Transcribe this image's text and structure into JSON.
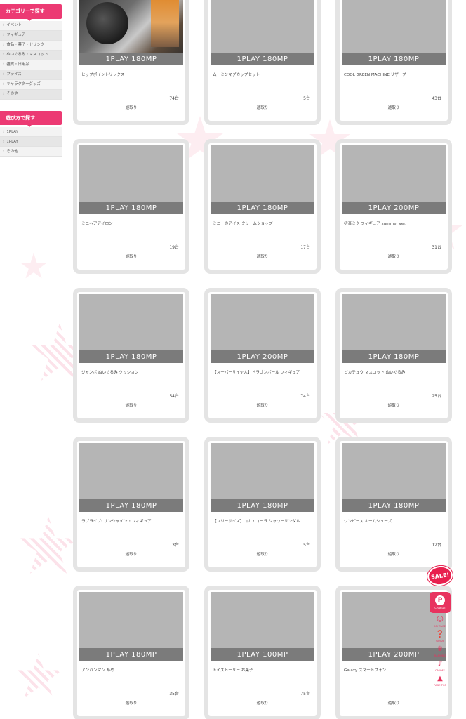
{
  "sidebar": {
    "category_header": "カテゴリーで探す",
    "categories": [
      {
        "label": "イベント"
      },
      {
        "label": "フィギュア"
      },
      {
        "label": "食品・菓子・ドリンク"
      },
      {
        "label": "ぬいぐるみ・マスコット"
      },
      {
        "label": "雑貨・日用品"
      },
      {
        "label": "プライズ"
      },
      {
        "label": "キャラクターグッズ"
      },
      {
        "label": "その他"
      }
    ],
    "play_header": "遊び方で探す",
    "plays": [
      {
        "label": "1PLAY"
      },
      {
        "label": "1PLAY"
      },
      {
        "label": "その他"
      }
    ]
  },
  "items": [
    {
      "price": "1PLAY 180MP",
      "name": "ヒップポイントリレクス",
      "count": "74台",
      "status": "遊取り"
    },
    {
      "price": "1PLAY 180MP",
      "name": "ムーミンマグカップセット",
      "count": "5台",
      "status": "遊取り"
    },
    {
      "price": "1PLAY 180MP",
      "name": "COOL GREEN MACHINE リザーブ",
      "count": "43台",
      "status": "遊取り"
    },
    {
      "price": "1PLAY 180MP",
      "name": "ミニヘアアイロン",
      "count": "19台",
      "status": "遊取り"
    },
    {
      "price": "1PLAY 180MP",
      "name": "ミニーのアイス クリームショップ",
      "count": "17台",
      "status": "遊取り"
    },
    {
      "price": "1PLAY 200MP",
      "name": "初音ミク フィギュア summer ver.",
      "count": "31台",
      "status": "遊取り"
    },
    {
      "price": "1PLAY 180MP",
      "name": "ジャンボ ぬいぐるみ クッション",
      "count": "54台",
      "status": "遊取り"
    },
    {
      "price": "1PLAY 200MP",
      "name": "【スーパーサイヤ人】ドラゴンボール フィギュア",
      "count": "74台",
      "status": "遊取り"
    },
    {
      "price": "1PLAY 180MP",
      "name": "ピカチュウ マスコット ぬいぐるみ",
      "count": "25台",
      "status": "遊取り"
    },
    {
      "price": "1PLAY 180MP",
      "name": "ラブライブ! サンシャイン!! フィギュア",
      "count": "3台",
      "status": "遊取り"
    },
    {
      "price": "1PLAY 180MP",
      "name": "【フリーサイズ】コカ・コーラ シャワーサンダル",
      "count": "5台",
      "status": "遊取り"
    },
    {
      "price": "1PLAY 180MP",
      "name": "ワンピース ルームシューズ",
      "count": "12台",
      "status": "遊取り"
    },
    {
      "price": "1PLAY 180MP",
      "name": "アンパンマン あめ",
      "count": "35台",
      "status": "遊取り"
    },
    {
      "price": "1PLAY 100MP",
      "name": "トイストーリー お菓子",
      "count": "75台",
      "status": "遊取り"
    },
    {
      "price": "1PLAY 200MP",
      "name": "Galaxy スマートフォン",
      "count": "",
      "status": "遊取り"
    }
  ],
  "float_nav": {
    "sale": "SALE!",
    "p_label": "P",
    "p_sub": "CHARGE",
    "buttons": [
      {
        "label": "MY PAGE",
        "icon": "user-icon"
      },
      {
        "label": "GUIDE",
        "icon": "guide-icon"
      },
      {
        "label": "RANKING",
        "icon": "crown-icon"
      },
      {
        "label": "ON/OFF",
        "icon": "sound-icon"
      },
      {
        "label": "PAGE TOP",
        "icon": "arrow-up-icon"
      }
    ]
  },
  "colors": {
    "accent": "#ec3a73",
    "price_bar": "#7b7b7b",
    "thumb": "#b5b5b5"
  }
}
